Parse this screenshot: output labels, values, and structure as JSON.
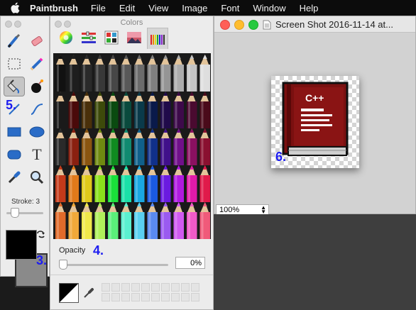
{
  "menubar": {
    "app_name": "Paintbrush",
    "items": [
      "File",
      "Edit",
      "View",
      "Image",
      "Font",
      "Window",
      "Help"
    ]
  },
  "tools": {
    "icons": [
      "brush-icon",
      "eraser-icon",
      "rect-select-icon",
      "pencil-icon",
      "fill-bucket-icon",
      "bomb-icon",
      "line-icon",
      "curve-icon",
      "rectangle-icon",
      "ellipse-icon",
      "rounded-rect-icon",
      "text-icon",
      "eyedropper-icon",
      "magnifier-icon"
    ],
    "text_tool_glyph": "T",
    "stroke_label": "Stroke: 3",
    "stroke_value": 3,
    "foreground_color": "#000000",
    "background_color": "#8a8a8a"
  },
  "colors_panel": {
    "title": "Colors",
    "tabs": [
      "color-wheel-icon",
      "sliders-icon",
      "palette-icon",
      "image-icon",
      "pencils-icon"
    ],
    "selected_tab": "pencils-icon",
    "opacity_label": "Opacity",
    "opacity_value": "0%"
  },
  "callouts": {
    "c3": "3.",
    "c4": "4.",
    "c5": "5.",
    "c6": "6."
  },
  "document": {
    "title": "Screen Shot 2016-11-14 at...",
    "zoom": "100%",
    "book_label": "C++"
  }
}
